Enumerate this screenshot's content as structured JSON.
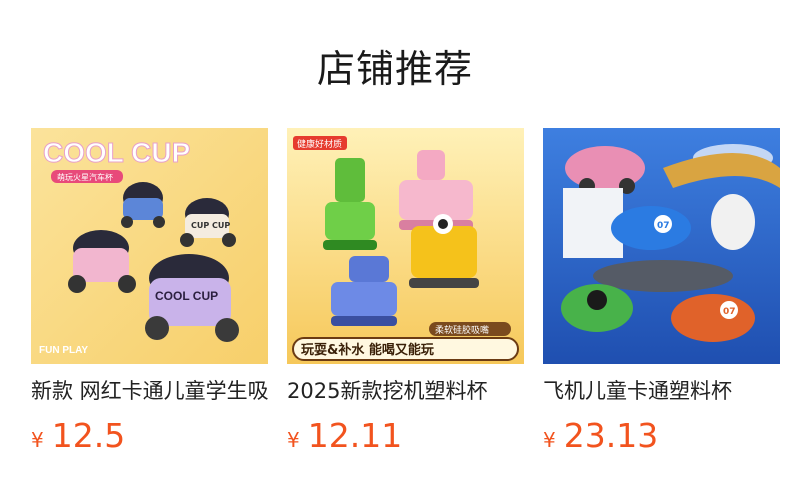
{
  "section": {
    "title": "店铺推荐"
  },
  "products": [
    {
      "name": "新款 网红卡通儿童学生吸管杯",
      "currency": "¥",
      "price": "12.5",
      "image_text": {
        "headline": "COOL CUP",
        "tag": "萌玩火星汽车杯",
        "cup_label": "CUP CUP",
        "cup_label2": "COOL CUP",
        "bottom": "FUN PLAY"
      }
    },
    {
      "name": "2025新款挖机塑料杯",
      "currency": "¥",
      "price": "12.11",
      "image_text": {
        "badge": "健康好材质",
        "tag": "柔软硅胶吸嘴",
        "banner": "玩耍&补水  能喝又能玩"
      }
    },
    {
      "name": "飞机儿童卡通塑料杯",
      "currency": "¥",
      "price": "23.13",
      "image_text": {
        "plane_number": "07",
        "plane_number2": "07"
      }
    }
  ]
}
